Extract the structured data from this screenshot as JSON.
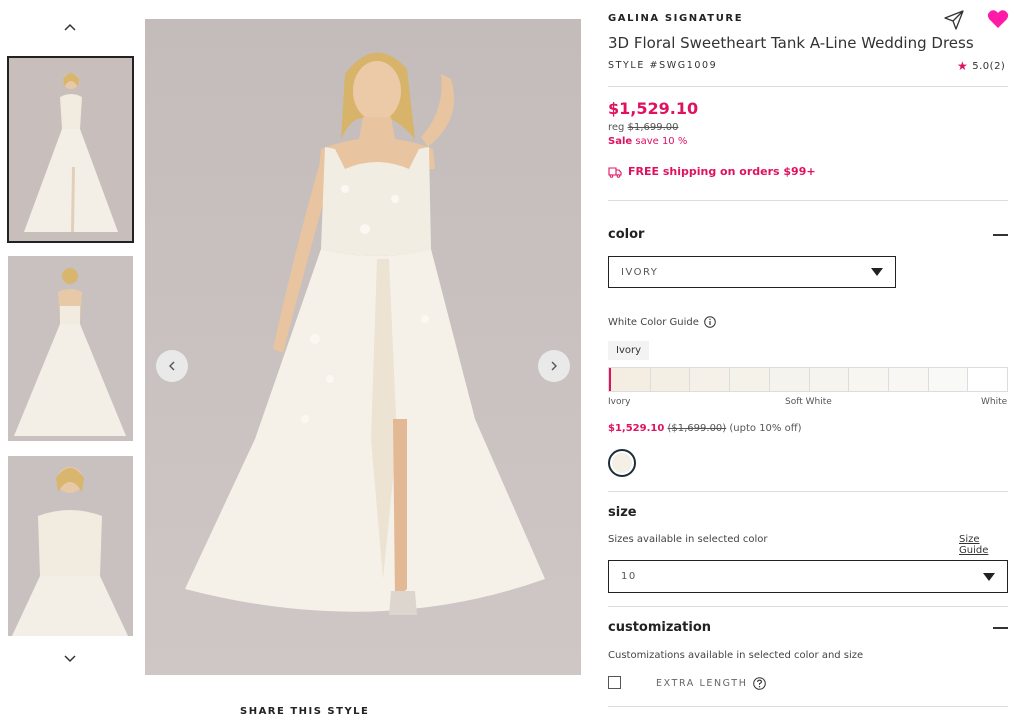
{
  "thumbnails": {
    "up_icon": "chevron-up-icon",
    "down_icon": "chevron-down-icon",
    "items": [
      "front view",
      "back view",
      "close-up view"
    ]
  },
  "gallery": {
    "prev_icon": "chevron-left-icon",
    "next_icon": "chevron-right-icon",
    "share_label": "SHARE THIS STYLE"
  },
  "product": {
    "brand": "GALINA SIGNATURE",
    "title": "3D Floral Sweetheart Tank A-Line Wedding Dress",
    "style": "STYLE #SWG1009",
    "rating": "5.0(2)",
    "price": "$1,529.10",
    "reg_label": "reg",
    "reg_price": "$1,699.00",
    "sale_label": "Sale",
    "sale_text": "save 10 %",
    "shipping": "FREE shipping on orders $99+"
  },
  "color": {
    "title": "color",
    "selected": "IVORY",
    "guide_label": "White Color Guide",
    "tooltip": "Ivory",
    "scale_left": "Ivory",
    "scale_mid": "Soft White",
    "scale_right": "White",
    "price": "$1,529.10",
    "reg_price": "($1,699.00)",
    "discount": "(upto 10% off)",
    "swatch_colors": [
      "#f3ede2",
      "#f4efe5",
      "#f5f1e8",
      "#f5f2ea",
      "#f5f3ed",
      "#f6f4ef",
      "#f7f6f1",
      "#f8f7f4",
      "#f9f9f7",
      "#ffffff"
    ],
    "accent": "#e0115f"
  },
  "size": {
    "title": "size",
    "note": "Sizes available in selected color",
    "guide_label": "Size Guide",
    "selected": "10"
  },
  "customization": {
    "title": "customization",
    "note": "Customizations available in selected color and size",
    "option_label": "EXTRA LENGTH"
  }
}
